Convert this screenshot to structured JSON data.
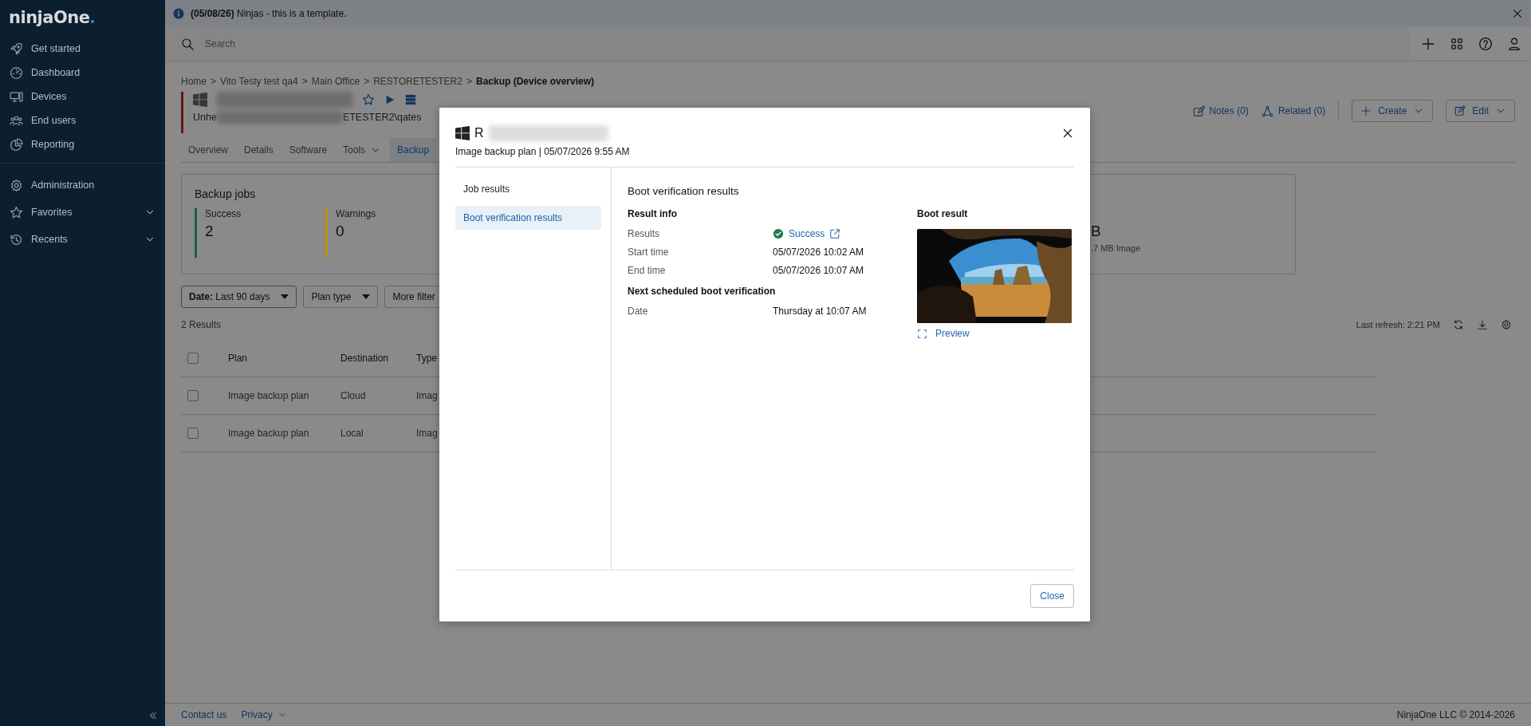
{
  "sidebar": {
    "logo": "ninjaOne",
    "items": [
      {
        "label": "Get started",
        "expandable": false
      },
      {
        "label": "Dashboard",
        "expandable": false
      },
      {
        "label": "Devices",
        "expandable": false
      },
      {
        "label": "End users",
        "expandable": false
      },
      {
        "label": "Reporting",
        "expandable": false
      }
    ],
    "admin_items": [
      {
        "label": "Administration",
        "expandable": false
      },
      {
        "label": "Favorites",
        "expandable": true
      },
      {
        "label": "Recents",
        "expandable": true
      }
    ]
  },
  "banner": {
    "message": "**(05/08/26)** Ninjas - this is a template."
  },
  "search": {
    "placeholder": "Search"
  },
  "breadcrumb": {
    "separator": ">",
    "items": [
      "Home",
      "Vito Testy test qa4",
      "Main Office",
      "RESTORETESTER2"
    ],
    "current": "Backup (Device overview)"
  },
  "device": {
    "path_start": "Unhe",
    "path_end": "ETESTER2\\qates"
  },
  "tabs": [
    {
      "label": "Overview",
      "selected": false,
      "has_menu": false
    },
    {
      "label": "Details",
      "selected": false,
      "has_menu": false
    },
    {
      "label": "Software",
      "selected": false,
      "has_menu": false
    },
    {
      "label": "Tools",
      "selected": false,
      "has_menu": true
    },
    {
      "label": "Backup",
      "selected": true,
      "has_menu": false
    }
  ],
  "actions": {
    "notes": "Notes (0)",
    "related": "Related (0)",
    "create": "Create",
    "edit": "Edit"
  },
  "summary": {
    "title": "Backup jobs",
    "stats": [
      {
        "label": "Success",
        "value": "2",
        "color": "#1b5e3a"
      },
      {
        "label": "Warnings",
        "value": "0",
        "color": "#b8960f"
      }
    ],
    "partial_value": "B",
    "partial_caption": ".7 MB Image"
  },
  "filters": [
    {
      "label": "**Date:** Last 90 days",
      "menu": true
    },
    {
      "label": "Plan type",
      "menu": true
    },
    {
      "label": "More filter",
      "menu": false
    }
  ],
  "results": "2 Results",
  "last_refresh": "Last refresh: 2:21 PM",
  "table": {
    "all_checked": false,
    "columns": [
      "Plan",
      "Destination",
      "Type"
    ],
    "rows": [
      {
        "checked": false,
        "cells": [
          "Image backup plan",
          "Cloud",
          "Imag"
        ]
      },
      {
        "checked": false,
        "cells": [
          "Image backup plan",
          "Local",
          "Imag"
        ]
      }
    ]
  },
  "footer": {
    "contact": "Contact us",
    "privacy": "Privacy",
    "copyright": "NinjaOne LLC © 2014-2026"
  },
  "modal": {
    "title": "R",
    "subtitle": "Image backup plan | 05/07/2026 9:55 AM",
    "nav": [
      {
        "label": "Job results",
        "selected": false
      },
      {
        "label": "Boot verification results",
        "selected": true
      }
    ],
    "heading": "Boot verification results",
    "sections": [
      {
        "title": "Result info",
        "rows": [
          {
            "label": "Results",
            "value": "Success",
            "kind": "status"
          },
          {
            "label": "Start time",
            "value": "05/07/2026 10:02 AM",
            "kind": "text"
          },
          {
            "label": "End time",
            "value": "05/07/2026 10:07 AM",
            "kind": "text"
          }
        ]
      },
      {
        "title": "Next scheduled boot verification",
        "rows": [
          {
            "label": "Date",
            "value": "Thursday at 10:07 AM",
            "kind": "text"
          }
        ]
      }
    ],
    "boot_result": {
      "title": "Boot result",
      "preview": "Preview"
    },
    "close": "Close"
  }
}
